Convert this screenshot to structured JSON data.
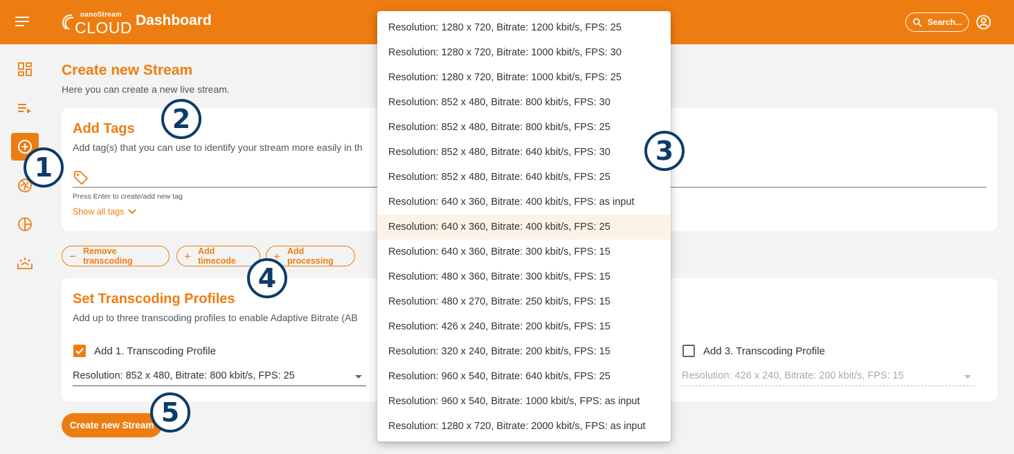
{
  "header": {
    "logo_small": "nanoStream",
    "logo_big": "CLOUD",
    "title": "Dashboard",
    "search_label": "Search..."
  },
  "page": {
    "title": "Create new Stream",
    "subtitle": "Here you can create a new live stream."
  },
  "tags_card": {
    "title": "Add Tags",
    "subtitle": "Add tag(s) that you can use to identify your stream more easily in th",
    "hint": "Press Enter to create/add new tag",
    "show_all": "Show all tags"
  },
  "actions": {
    "remove_transcoding": "Remove transcoding",
    "add_timecode": "Add timecode",
    "add_processing": "Add processing"
  },
  "transcoding_card": {
    "title": "Set Transcoding Profiles",
    "subtitle": "Add up to three transcoding profiles to enable Adaptive Bitrate (AB",
    "profile1_label": "Add 1. Transcoding Profile",
    "profile1_checked": true,
    "profile1_value": "Resolution: 852 x 480, Bitrate: 800 kbit/s, FPS: 25",
    "profile3_label": "Add 3. Transcoding Profile",
    "profile3_checked": false,
    "profile3_value": "Resolution: 426 x 240, Bitrate: 200 kbit/s, FPS: 15"
  },
  "create_button": "Create new Stream",
  "dropdown": {
    "highlighted_index": 8,
    "options": [
      "Resolution: 1280 x 720, Bitrate: 1200 kbit/s, FPS: 25",
      "Resolution: 1280 x 720, Bitrate: 1000 kbit/s, FPS: 30",
      "Resolution: 1280 x 720, Bitrate: 1000 kbit/s, FPS: 25",
      "Resolution: 852 x 480, Bitrate: 800 kbit/s, FPS: 30",
      "Resolution: 852 x 480, Bitrate: 800 kbit/s, FPS: 25",
      "Resolution: 852 x 480, Bitrate: 640 kbit/s, FPS: 30",
      "Resolution: 852 x 480, Bitrate: 640 kbit/s, FPS: 25",
      "Resolution: 640 x 360, Bitrate: 400 kbit/s, FPS: as input",
      "Resolution: 640 x 360, Bitrate: 400 kbit/s, FPS: 25",
      "Resolution: 640 x 360, Bitrate: 300 kbit/s, FPS: 15",
      "Resolution: 480 x 360, Bitrate: 300 kbit/s, FPS: 15",
      "Resolution: 480 x 270, Bitrate: 250 kbit/s, FPS: 15",
      "Resolution: 426 x 240, Bitrate: 200 kbit/s, FPS: 15",
      "Resolution: 320 x 240, Bitrate: 200 kbit/s, FPS: 15",
      "Resolution: 960 x 540, Bitrate: 640 kbit/s, FPS: 25",
      "Resolution: 960 x 540, Bitrate: 1000 kbit/s, FPS: as input",
      "Resolution: 1280 x 720, Bitrate: 2000 kbit/s, FPS: as input"
    ]
  },
  "callouts": [
    "1",
    "2",
    "3",
    "4",
    "5"
  ],
  "colors": {
    "accent": "#ee7d11",
    "callout": "#0c3c6a",
    "highlight": "#fdf2e7"
  },
  "icons": {
    "menu": "hamburger-icon",
    "search": "search-icon",
    "user": "user-icon",
    "sidebar": [
      "dashboard-icon",
      "stream-list-icon",
      "add-stream-icon",
      "player-icon",
      "analytics-icon",
      "ingest-icon"
    ],
    "tag": "tag-icon",
    "chevron": "chevron-down-icon"
  }
}
